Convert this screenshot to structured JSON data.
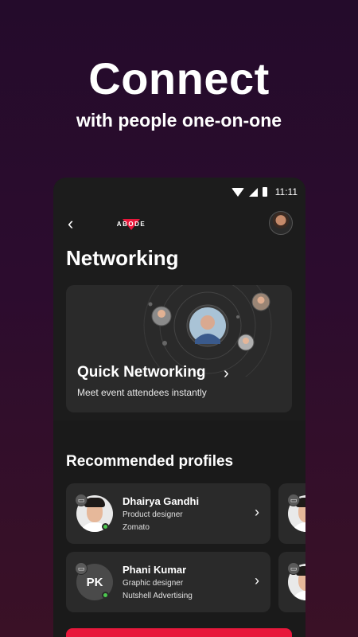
{
  "promo": {
    "title": "Connect",
    "subtitle": "with people one-on-one"
  },
  "status_bar": {
    "time": "11:11",
    "icons": [
      "wifi-icon",
      "signal-icon",
      "battery-icon"
    ]
  },
  "header": {
    "back_icon": "back-arrow-icon",
    "logo_text": "ABODE",
    "avatar": "user-avatar"
  },
  "page": {
    "title": "Networking"
  },
  "quick_networking": {
    "title": "Quick Networking",
    "subtitle": "Meet event attendees instantly",
    "chevron_icon": "chevron-right-icon"
  },
  "recommended": {
    "title": "Recommended profiles",
    "profiles": [
      {
        "name": "Dhairya Gandhi",
        "role": "Product designer",
        "company": "Zomato",
        "online": true
      },
      {
        "name": "Phani Kumar",
        "initials": "PK",
        "role": "Graphic designer",
        "company": "Nutshell Advertising",
        "online": true
      }
    ]
  },
  "colors": {
    "accent": "#e8173b",
    "background_top": "#240b2b",
    "card": "#2a2a2a",
    "online": "#4cc94f"
  }
}
